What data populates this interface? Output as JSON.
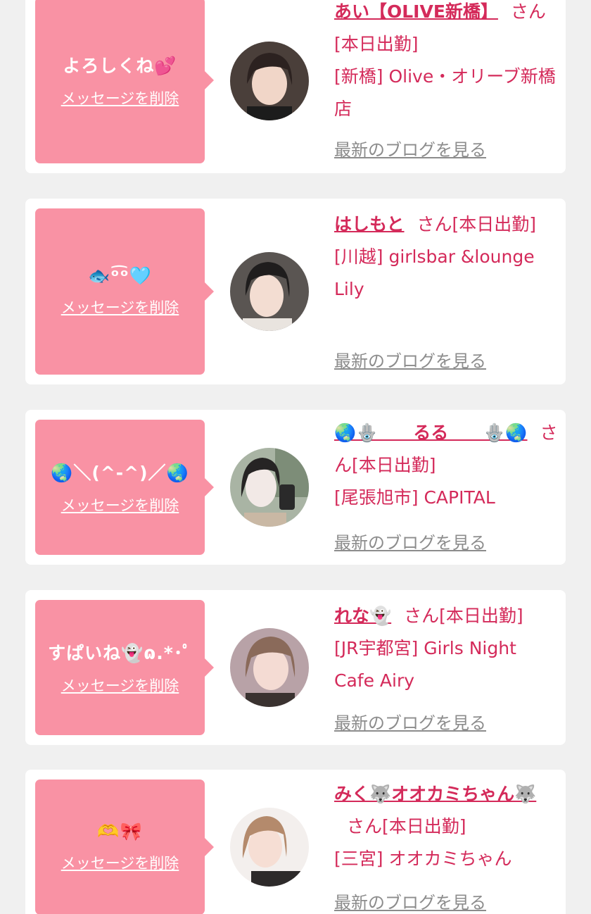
{
  "delete_label": "メッセージを削除",
  "blog_label": "最新のブログを見る",
  "san_text": "さん[本日出勤]",
  "colors": {
    "page_bg": "#f0f0f0",
    "card_bg": "#ffffff",
    "bubble_bg": "#f992a4",
    "accent": "#d42a5a",
    "muted": "#8c8c8c"
  },
  "entries": [
    {
      "message": "よろしくね💕",
      "name": "あい【OLIVE新橋】",
      "shop": "[新橋] Olive・オリーブ新橋店"
    },
    {
      "message": "🐟ᵒ͡ᵒ🩵",
      "name": "はしもと",
      "shop": "[川越] girlsbar &lounge Lily"
    },
    {
      "message": "🌏＼(^-^)／🌏",
      "name": "🌏🪬　　るる　　🪬🌏",
      "shop": "[尾張旭市] CAPITAL"
    },
    {
      "message": "すぱいね👻ɷ.*･ﾟ",
      "name": "れな👻",
      "shop": "[JR宇都宮] Girls Night Cafe Airy"
    },
    {
      "message": "🫶🎀",
      "name": "みく🐺オオカミちゃん🐺",
      "shop": "[三宮] オオカミちゃん"
    }
  ]
}
